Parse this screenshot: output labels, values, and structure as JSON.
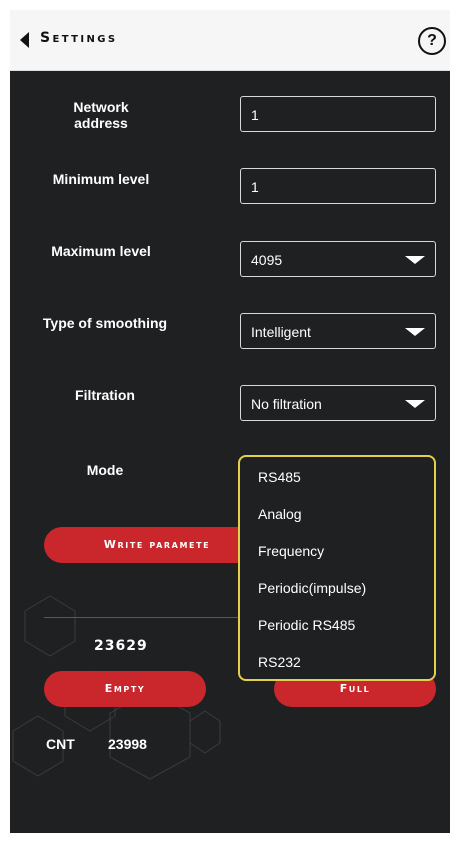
{
  "header": {
    "title": "Settings",
    "help_label": "?"
  },
  "form": {
    "network_address": {
      "label": "Network address",
      "value": "1"
    },
    "minimum_level": {
      "label": "Minimum level",
      "value": "1"
    },
    "maximum_level": {
      "label": "Maximum level",
      "value": "4095"
    },
    "smoothing": {
      "label": "Type of smoothing",
      "value": "Intelligent"
    },
    "filtration": {
      "label": "Filtration",
      "value": "No filtration"
    },
    "mode": {
      "label": "Mode"
    }
  },
  "mode_dropdown": {
    "options": [
      "RS485",
      "Analog",
      "Frequency",
      "Periodic(impulse)",
      "Periodic RS485",
      "RS232"
    ]
  },
  "buttons": {
    "write_parameters": "Write paramete",
    "empty": "Empty",
    "full": "Full"
  },
  "readings": {
    "current_value": "23629",
    "cnt_label": "CNT",
    "cnt_value": "23998"
  },
  "colors": {
    "accent": "#c9272b",
    "background": "#1f2022",
    "highlight": "#e3d04a"
  },
  "icons": {
    "back": "back-triangle-icon",
    "help": "help-circle-icon",
    "dropdown": "caret-down-icon"
  }
}
